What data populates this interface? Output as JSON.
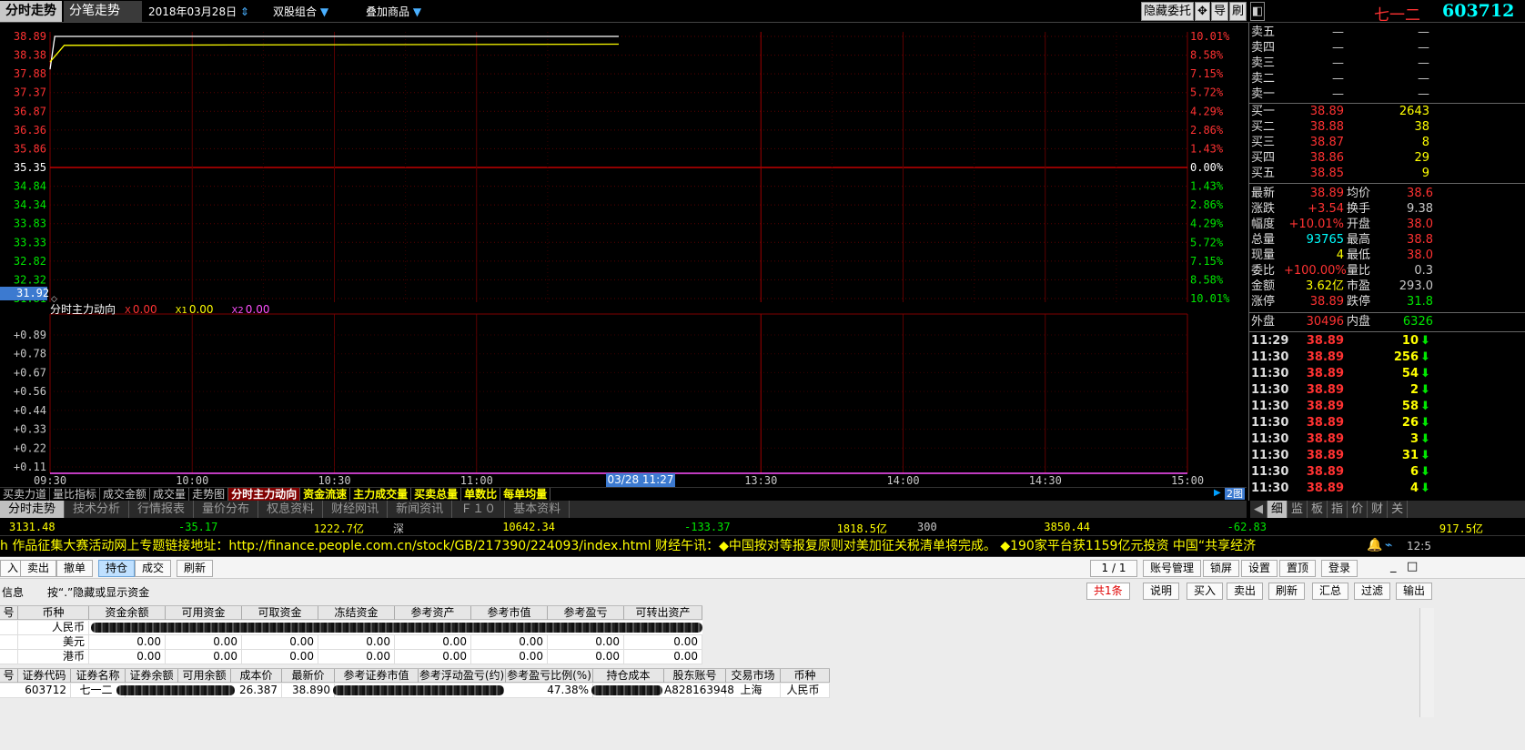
{
  "topbar": {
    "tab_active": "分时走势",
    "tab_other": "分笔走势",
    "date": "2018年03月28日",
    "combo1": "双股组合",
    "combo2": "叠加商品",
    "hide_order": "隐藏委托",
    "btn_dao": "导",
    "btn_shua": "刷",
    "stock_name": "七一二",
    "stock_code": "603712"
  },
  "chart_data": {
    "type": "line",
    "x_ticks": [
      "09:30",
      "10:00",
      "10:30",
      "11:00",
      "13:30",
      "14:00",
      "14:30",
      "15:00"
    ],
    "y_price_ticks": [
      "38.89",
      "38.38",
      "37.88",
      "37.37",
      "36.87",
      "36.36",
      "35.86",
      "35.35",
      "34.84",
      "34.34",
      "33.83",
      "33.33",
      "32.82",
      "32.32",
      "31.81"
    ],
    "y_pct_ticks": [
      "10.01%",
      "8.58%",
      "7.15%",
      "5.72%",
      "4.29%",
      "2.86%",
      "1.43%",
      "0.00%",
      "1.43%",
      "2.86%",
      "4.29%",
      "5.72%",
      "7.15%",
      "8.58%",
      "10.01%"
    ],
    "prev_close": 35.35,
    "ylim": [
      31.81,
      38.89
    ],
    "series": [
      {
        "name": "price",
        "color": "#ffffff",
        "points": [
          [
            "09:30",
            38.0
          ],
          [
            "09:31",
            38.89
          ],
          [
            "11:30",
            38.89
          ]
        ]
      },
      {
        "name": "avg",
        "color": "#ffff00",
        "points": [
          [
            "09:30",
            38.2
          ],
          [
            "09:33",
            38.65
          ],
          [
            "11:30",
            38.68
          ]
        ]
      }
    ],
    "sub_y_ticks": [
      "+0.89",
      "+0.78",
      "+0.67",
      "+0.56",
      "+0.44",
      "+0.33",
      "+0.22",
      "+0.11"
    ],
    "price_cursor": "31.92",
    "time_cursor": "03/28 11:27",
    "sub_title": "分时主力动向",
    "sub_x_label": "X",
    "sub_x_value": "0.00",
    "sub_x1_label": "X1",
    "sub_x1_value": "0.00",
    "sub_x2_label": "X2",
    "sub_x2_value": "0.00"
  },
  "indicators": [
    "买卖力道",
    "量比指标",
    "成交金额",
    "成交量",
    "走势图",
    "分时主力动向",
    "资金流速",
    "主力成交量",
    "买卖总量",
    "单数比",
    "每单均量"
  ],
  "indicator_active": 5,
  "nav_tabs": [
    "分时走势",
    "技术分析",
    "行情报表",
    "量价分布",
    "权息资料",
    "财经网讯",
    "新闻资讯",
    "Ｆ１０",
    "基本资料"
  ],
  "nav_right_label": "2图",
  "right_tabs": [
    "◀",
    "细",
    "监",
    "板",
    "指",
    "价",
    "财",
    "关"
  ],
  "index_row": [
    {
      "text": "3131.48",
      "color": "#ffff00"
    },
    {
      "text": "-35.17",
      "color": "#00e600"
    },
    {
      "text": "1222.7亿",
      "color": "#ffff00"
    },
    {
      "text": "深",
      "color": "#c8c8c8"
    },
    {
      "text": "10642.34",
      "color": "#ffff00"
    },
    {
      "text": "-133.37",
      "color": "#00e600"
    },
    {
      "text": "1818.5亿",
      "color": "#ffff00"
    },
    {
      "text": "300",
      "color": "#c8c8c8"
    },
    {
      "text": "3850.44",
      "color": "#ffff00"
    },
    {
      "text": "-62.83",
      "color": "#00e600"
    },
    {
      "text": "917.5亿",
      "color": "#ffff00"
    }
  ],
  "ticker": "h 作品征集大赛活动网上专题链接地址：http://finance.people.com.cn/stock/GB/217390/224093/index.html    财经午讯：◆中国按对等报复原则对美加征关税清单将完成。   ◆190家平台获1159亿元投资 中国“共享经济",
  "ticker_time": "12:5",
  "sell_orders": [
    {
      "label": "卖五",
      "price": "—",
      "vol": "—"
    },
    {
      "label": "卖四",
      "price": "—",
      "vol": "—"
    },
    {
      "label": "卖三",
      "price": "—",
      "vol": "—"
    },
    {
      "label": "卖二",
      "price": "—",
      "vol": "—"
    },
    {
      "label": "卖一",
      "price": "—",
      "vol": "—"
    }
  ],
  "buy_orders": [
    {
      "label": "买一",
      "price": "38.89",
      "vol": "2643"
    },
    {
      "label": "买二",
      "price": "38.88",
      "vol": "38"
    },
    {
      "label": "买三",
      "price": "38.87",
      "vol": "8"
    },
    {
      "label": "买四",
      "price": "38.86",
      "vol": "29"
    },
    {
      "label": "买五",
      "price": "38.85",
      "vol": "9"
    }
  ],
  "quote": [
    {
      "l1": "最新",
      "v1": "38.89",
      "c1": "#ff3232",
      "l2": "均价",
      "v2": "38.6",
      "c2": "#ff3232"
    },
    {
      "l1": "涨跌",
      "v1": "+3.54",
      "c1": "#ff3232",
      "l2": "换手",
      "v2": "9.38",
      "c2": "#c8c8c8"
    },
    {
      "l1": "幅度",
      "v1": "+10.01%",
      "c1": "#ff3232",
      "l2": "开盘",
      "v2": "38.0",
      "c2": "#ff3232"
    },
    {
      "l1": "总量",
      "v1": "93765",
      "c1": "#00ffff",
      "l2": "最高",
      "v2": "38.8",
      "c2": "#ff3232"
    },
    {
      "l1": "现量",
      "v1": "4",
      "c1": "#ffff00",
      "l2": "最低",
      "v2": "38.0",
      "c2": "#ff3232"
    },
    {
      "l1": "委比",
      "v1": "+100.00%",
      "c1": "#ff3232",
      "l2": "量比",
      "v2": "0.3",
      "c2": "#c8c8c8"
    },
    {
      "l1": "金额",
      "v1": "3.62亿",
      "c1": "#ffff00",
      "l2": "市盈",
      "v2": "293.0",
      "c2": "#c8c8c8"
    },
    {
      "l1": "涨停",
      "v1": "38.89",
      "c1": "#ff3232",
      "l2": "跌停",
      "v2": "31.8",
      "c2": "#00e600"
    }
  ],
  "outer": {
    "l1": "外盘",
    "v1": "30496",
    "l2": "内盘",
    "v2": "6326"
  },
  "ticks": [
    {
      "t": "11:29",
      "p": "38.89",
      "v": "10"
    },
    {
      "t": "11:30",
      "p": "38.89",
      "v": "256"
    },
    {
      "t": "11:30",
      "p": "38.89",
      "v": "54"
    },
    {
      "t": "11:30",
      "p": "38.89",
      "v": "2"
    },
    {
      "t": "11:30",
      "p": "38.89",
      "v": "58"
    },
    {
      "t": "11:30",
      "p": "38.89",
      "v": "26"
    },
    {
      "t": "11:30",
      "p": "38.89",
      "v": "3"
    },
    {
      "t": "11:30",
      "p": "38.89",
      "v": "31"
    },
    {
      "t": "11:30",
      "p": "38.89",
      "v": "6"
    },
    {
      "t": "11:30",
      "p": "38.89",
      "v": "4"
    }
  ],
  "trade": {
    "toolbar": [
      "入",
      "卖出",
      "撤单",
      "持仓",
      "成交",
      "刷新"
    ],
    "toolbar_active": 3,
    "page": "1 / 1",
    "right_buttons": [
      "账号管理",
      "锁屏",
      "设置",
      "置顶",
      "登录"
    ],
    "win_min": "_",
    "win_max": "□",
    "info_label": "信息",
    "toggle_hint": "按“.”隐藏或显示资金",
    "count": "共1条",
    "row2_buttons": [
      "说明",
      "买入",
      "卖出",
      "刷新",
      "汇总",
      "过滤",
      "输出"
    ],
    "fund_headers": [
      "号",
      "币种",
      "资金余额",
      "可用资金",
      "可取资金",
      "冻结资金",
      "参考资产",
      "参考市值",
      "参考盈亏",
      "可转出资产"
    ],
    "fund_rows": [
      {
        "currency": "人民币",
        "values": [
          "",
          "",
          "",
          "",
          "",
          "",
          "",
          ""
        ]
      },
      {
        "currency": "美元",
        "values": [
          "0.00",
          "0.00",
          "0.00",
          "0.00",
          "0.00",
          "0.00",
          "0.00",
          "0.00"
        ]
      },
      {
        "currency": "港币",
        "values": [
          "0.00",
          "0.00",
          "0.00",
          "0.00",
          "0.00",
          "0.00",
          "0.00",
          "0.00"
        ]
      }
    ],
    "pos_headers": [
      "号",
      "证券代码",
      "证券名称",
      "证券余额",
      "可用余额",
      "成本价",
      "最新价",
      "参考证券市值",
      "参考浮动盈亏(约)",
      "参考盈亏比例(%)",
      "持仓成本",
      "股东账号",
      "交易市场",
      "币种"
    ],
    "pos_row": {
      "code": "603712",
      "name": "七一二",
      "cost": "26.387",
      "last": "38.890",
      "ratio": "47.38%",
      "account": "A828163948",
      "market": "上海",
      "currency": "人民币"
    }
  }
}
